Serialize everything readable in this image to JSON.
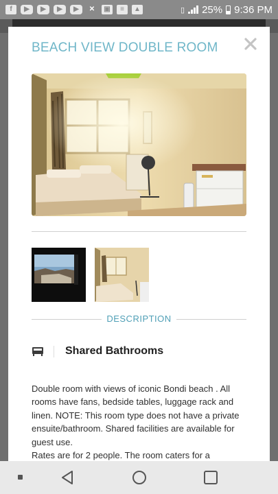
{
  "status_bar": {
    "notification_icons": [
      "facebook-icon",
      "youtube-icon",
      "youtube-icon",
      "youtube-icon",
      "youtube-icon",
      "missed-call-icon",
      "gallery-icon",
      "news-icon",
      "image-icon"
    ],
    "battery": "25%",
    "time": "9:36 PM"
  },
  "modal": {
    "title": "BEACH VIEW DOUBLE ROOM",
    "close_icon": "close-icon",
    "description_label": "DESCRIPTION",
    "feature_icon": "bathtub-icon",
    "feature_label": "Shared Bathrooms",
    "description_paragraphs": [
      "Double room with views of iconic Bondi beach . All rooms have fans, bedside tables, luggage rack and linen. NOTE: This room type does not have a private ensuite/bathroom. Shared facilities are available for guest use.",
      "Rates are for 2 people. The room caters for a"
    ]
  },
  "nav_bar": {
    "buttons": [
      "back-icon",
      "home-icon",
      "recent-apps-icon"
    ]
  },
  "colors": {
    "title": "#6fb6c8",
    "accent": "#4f9fb6",
    "nav_bg": "#e9e9e9",
    "status_bg": "#8a8a8a"
  }
}
